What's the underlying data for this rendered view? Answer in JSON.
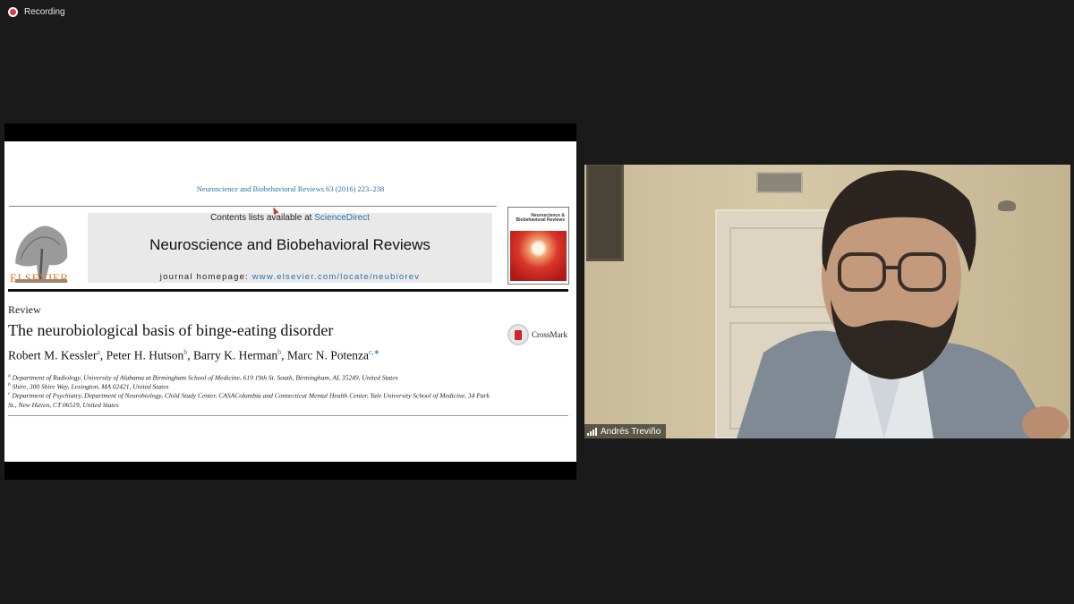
{
  "recording": {
    "label": "Recording"
  },
  "paper": {
    "citation": "Neuroscience and Biobehavioral Reviews 63 (2016) 223–238",
    "contents_prefix": "Contents lists available at ",
    "contents_link": "ScienceDirect",
    "journal_title": "Neuroscience and Biobehavioral Reviews",
    "homepage_prefix": "journal homepage: ",
    "homepage_url": "www.elsevier.com/locate/neubiorev",
    "publisher": "ELSEVIER",
    "cover_title": "Neuroscience & Biobehavioral Reviews",
    "section": "Review",
    "title": "The neurobiological basis of binge-eating disorder",
    "crossmark": "CrossMark",
    "authors": [
      {
        "name": "Robert M. Kessler",
        "sup": "a"
      },
      {
        "name": "Peter H. Hutson",
        "sup": "b"
      },
      {
        "name": "Barry K. Herman",
        "sup": "b"
      },
      {
        "name": "Marc N. Potenza",
        "sup": "c,∗"
      }
    ],
    "affiliations": [
      {
        "sup": "a",
        "text": "Department of Radiology, University of Alabama at Birmingham School of Medicine, 619 19th St. South, Birmingham, AL 35249, United States"
      },
      {
        "sup": "b",
        "text": "Shire, 300 Shire Way, Lexington, MA 02421, United States"
      },
      {
        "sup": "c",
        "text": "Department of Psychiatry, Department of Neurobiology, Child Study Center, CASAColumbia and Connecticut Mental Health Center, Yale University School of Medicine, 34 Park St., New Haven, CT 06519, United States"
      }
    ]
  },
  "participant": {
    "name": "Andrés Treviño",
    "icon": "signal-bars-icon"
  },
  "colors": {
    "link": "#2a6fa8",
    "elsevier": "#e5731c",
    "record": "#e0383e"
  }
}
